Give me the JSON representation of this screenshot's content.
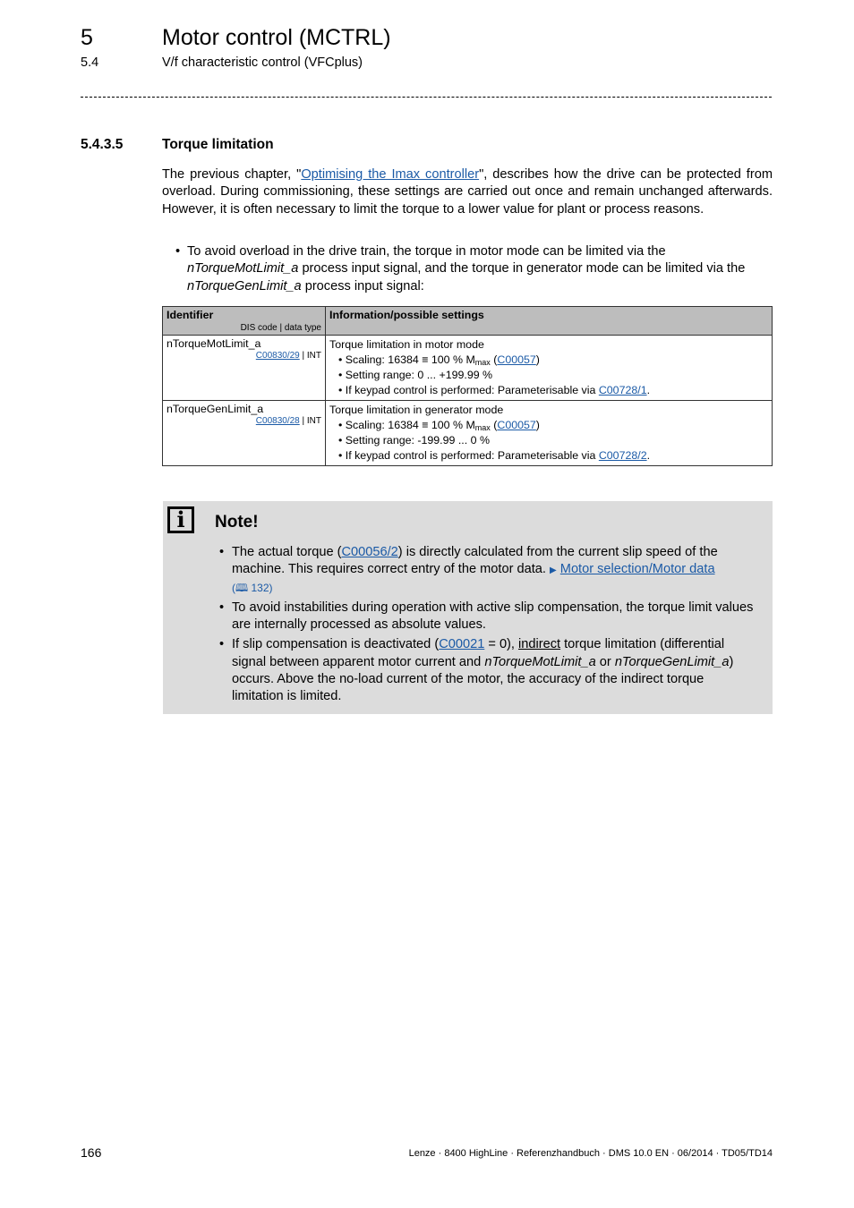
{
  "header": {
    "chapter_number": "5",
    "chapter_title": "Motor control (MCTRL)",
    "section_number": "5.4",
    "section_title": "V/f characteristic control (VFCplus)"
  },
  "section": {
    "number": "5.4.3.5",
    "title": "Torque limitation"
  },
  "intro": {
    "before_link": "The previous chapter, \"",
    "link": "Optimising the Imax controller",
    "after_link": "\", describes how the drive can be protected from overload. During commissioning, these settings are carried out once and remain unchanged afterwards. However, it is often necessary to limit the torque to a lower value for plant or process reasons."
  },
  "bullet": {
    "part1": "To avoid overload in the drive train, the torque in motor mode can be limited via the ",
    "signal1": "nTorqueMotLimit_a",
    "part2": " process input signal, and the torque in generator mode can be limited via the ",
    "signal2": "nTorqueGenLimit_a",
    "part3": " process input signal:"
  },
  "table": {
    "headers": {
      "identifier": "Identifier",
      "identifier_sub": "DIS code | data type",
      "info": "Information/possible settings"
    },
    "rows": [
      {
        "identifier": "nTorqueMotLimit_a",
        "code": "C00830/29",
        "type": "| INT",
        "title": "Torque limitation in motor mode",
        "scaling_prefix": "Scaling: 16384 ≡ 100 % M",
        "scaling_sub": "max",
        "scaling_link": "C00057",
        "range": "Setting range: 0 ... +199.99 %",
        "keypad_prefix": "If keypad control is performed: Parameterisable via ",
        "keypad_link": "C00728/1"
      },
      {
        "identifier": "nTorqueGenLimit_a",
        "code": "C00830/28",
        "type": "| INT",
        "title": "Torque limitation in generator mode",
        "scaling_prefix": "Scaling: 16384 ≡ 100 % M",
        "scaling_sub": "max",
        "scaling_link": "C00057",
        "range": "Setting range: -199.99 ... 0 %",
        "keypad_prefix": "If keypad control is performed: Parameterisable via ",
        "keypad_link": "C00728/2"
      }
    ]
  },
  "note": {
    "icon": "info-icon",
    "icon_glyph": "i",
    "title": "Note!",
    "items": [
      {
        "a": "The actual torque (",
        "link": "C00056/2",
        "b": ") is directly calculated from the current slip speed of the machine. This requires correct entry of the motor data. ",
        "ref_link": "Motor selection/Motor data",
        "page_ref": "(🕮 132)"
      },
      {
        "text": "To avoid instabilities during operation with active slip compensation, the torque limit values are internally processed as absolute values."
      },
      {
        "a": "If slip compensation is deactivated (",
        "link": "C00021",
        "b": " = 0), ",
        "underlined": "indirect",
        "c": " torque limitation (differential signal between apparent motor current and ",
        "signal1": "nTorqueMotLimit_a",
        "d": " or ",
        "signal2": "nTorqueGenLimit_a",
        "e": ") occurs. Above the no-load current of the motor, the accuracy of the indirect torque limitation is limited."
      }
    ]
  },
  "footer": {
    "page_number": "166",
    "doc_info": "Lenze · 8400 HighLine · Referenzhandbuch · DMS 10.0 EN · 06/2014 · TD05/TD14"
  }
}
